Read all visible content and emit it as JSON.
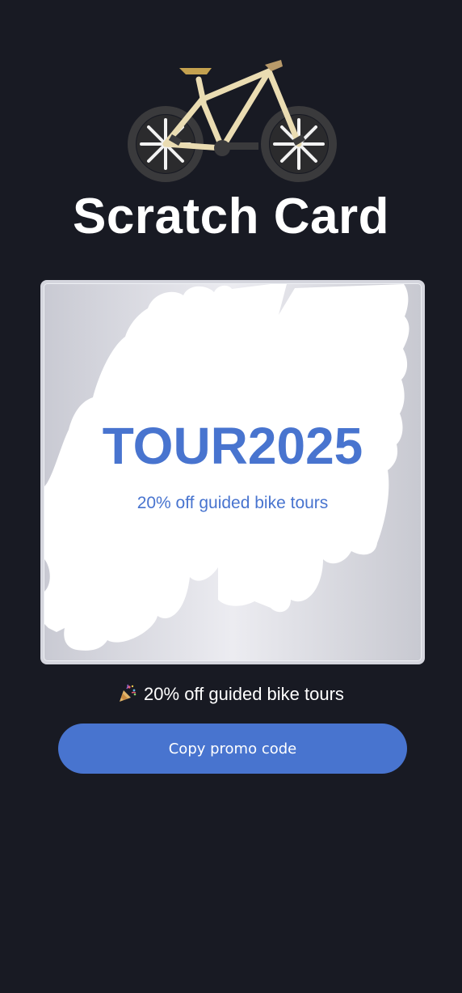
{
  "header": {
    "icon": "bicycle-icon",
    "title": "Scratch Card"
  },
  "card": {
    "code": "TOUR2025",
    "description": "20% off guided bike tours",
    "revealed_fraction": 0.7
  },
  "result": {
    "icon": "party-popper-icon",
    "text": "20% off guided bike tours"
  },
  "actions": {
    "copy_label": "Copy promo code"
  },
  "colors": {
    "background": "#181a23",
    "accent": "#4874cf",
    "foil": "#d5d6de"
  }
}
